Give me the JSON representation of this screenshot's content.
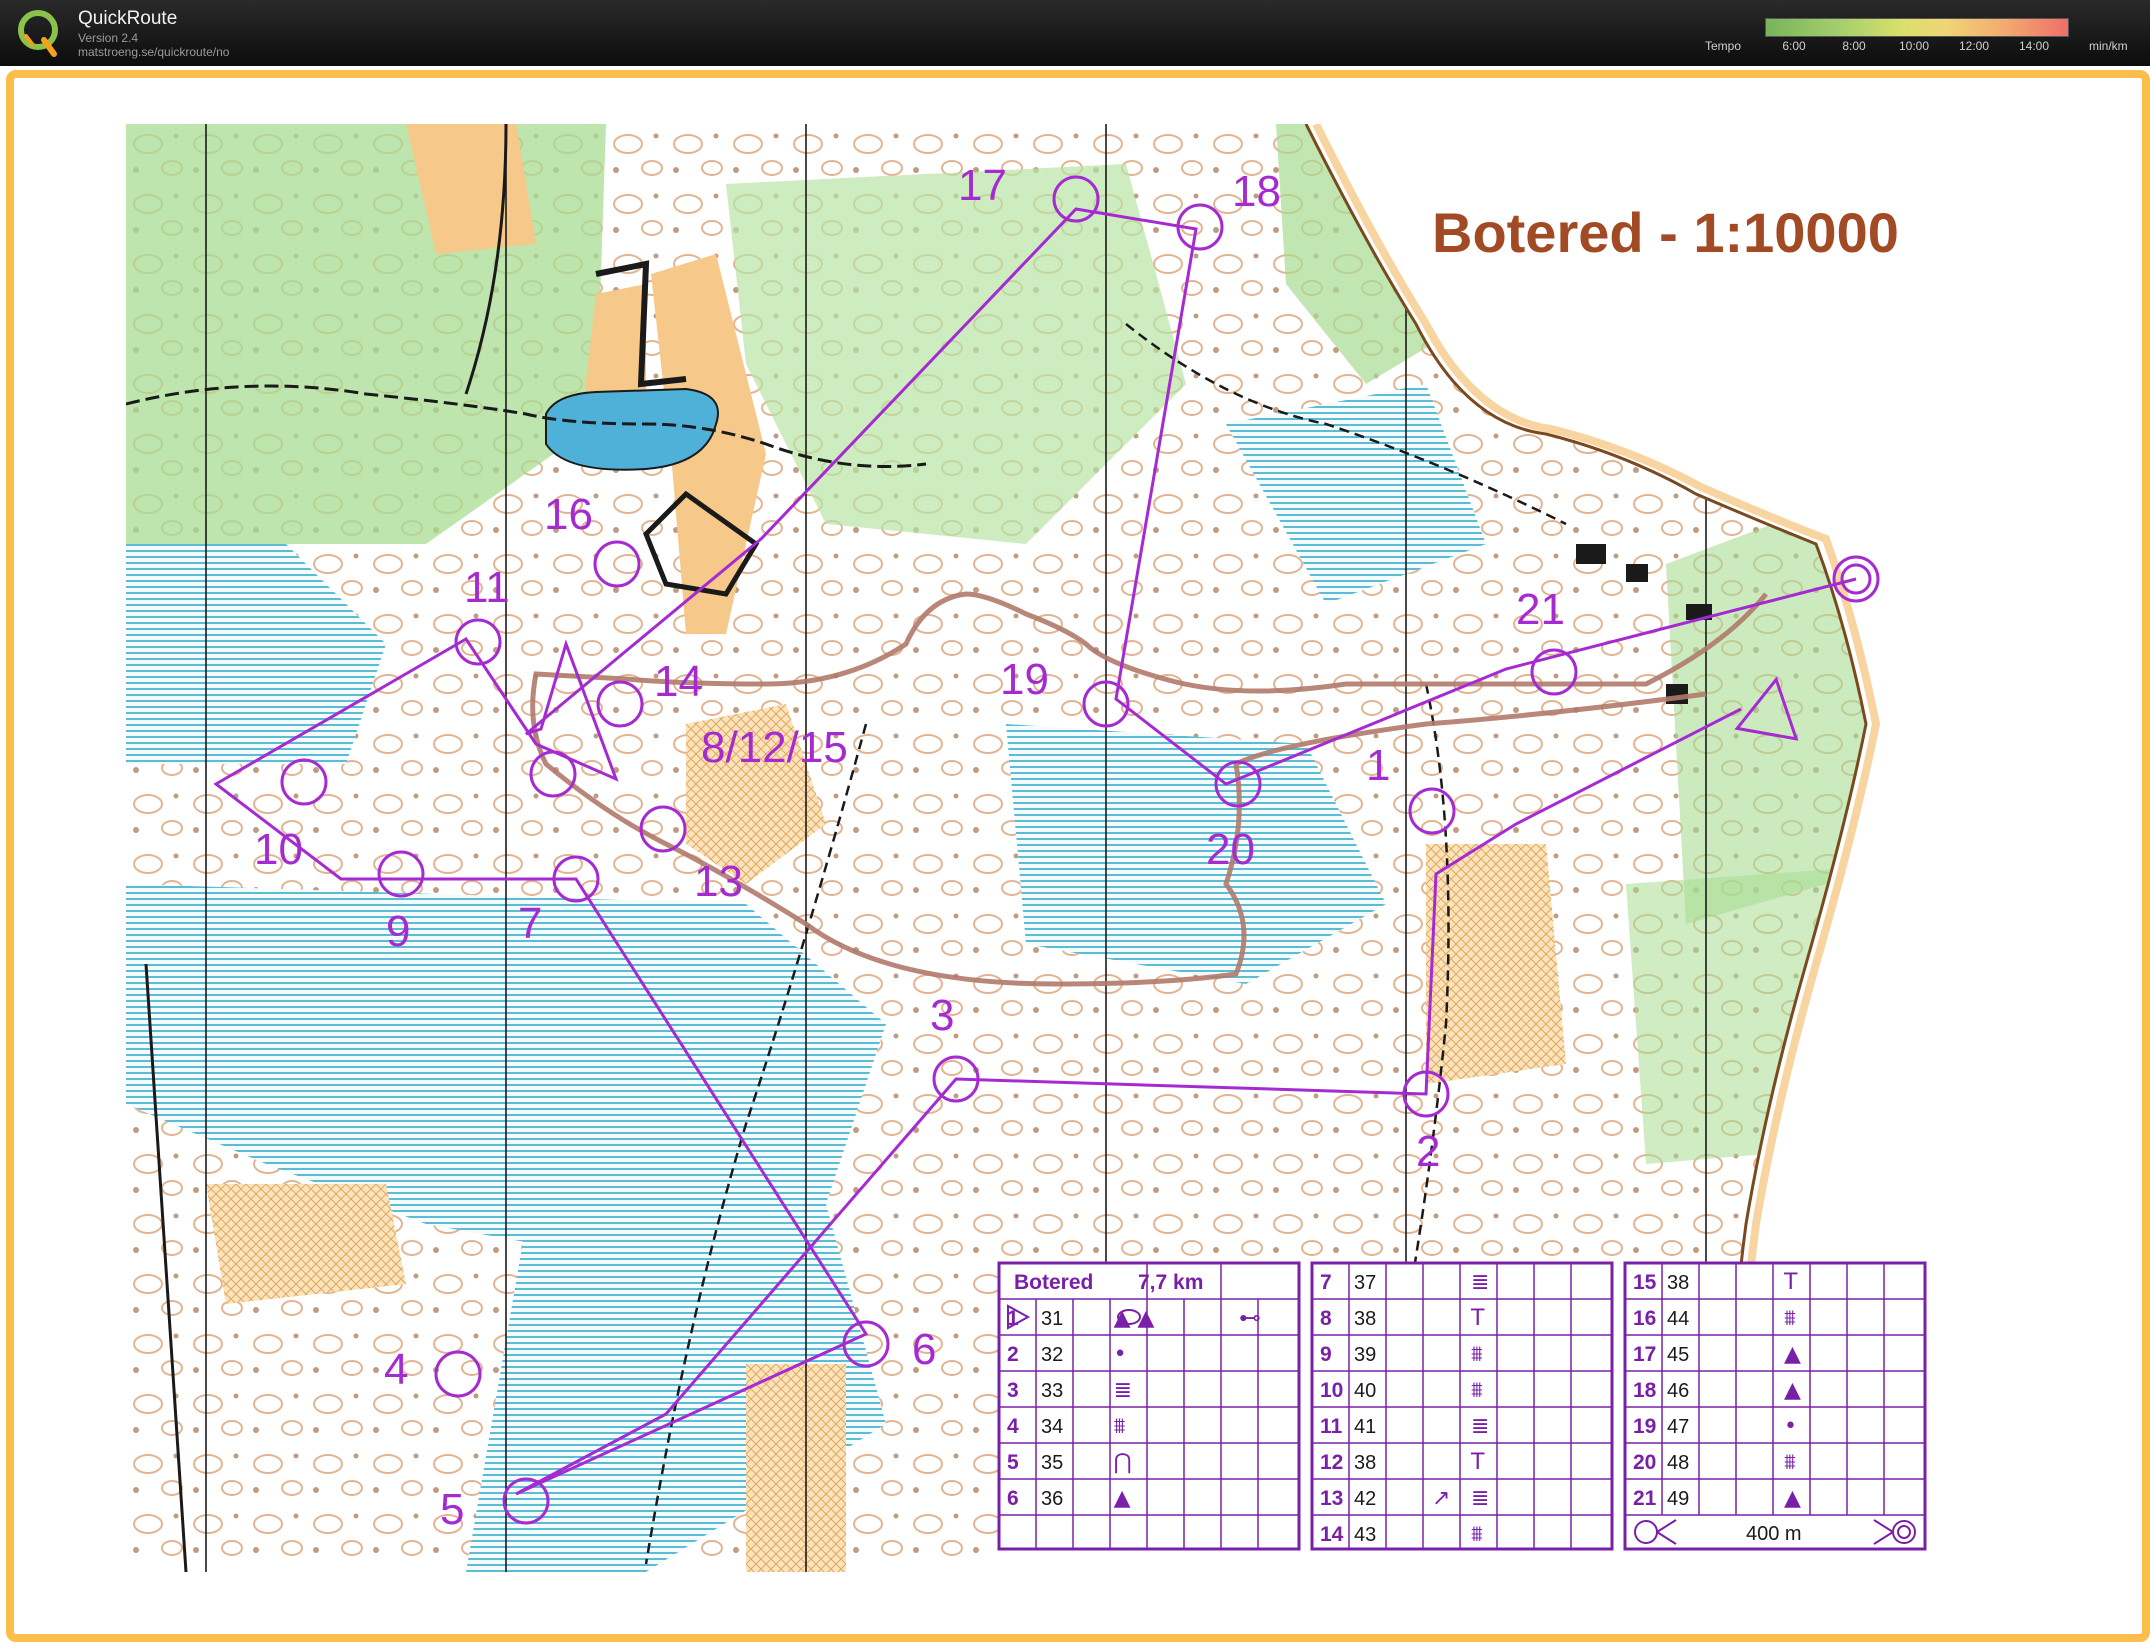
{
  "app": {
    "title": "QuickRoute",
    "version": "Version 2.4",
    "url": "matstroeng.se/quickroute/no"
  },
  "tempo": {
    "label": "Tempo",
    "ticks": [
      "6:00",
      "8:00",
      "10:00",
      "12:00",
      "14:00"
    ],
    "unit": "min/km"
  },
  "map": {
    "title": "Botered - 1:10000",
    "start_label": "start-triangle",
    "finish_label": "finish-double-circle"
  },
  "controls": [
    {
      "label": "1"
    },
    {
      "label": "2"
    },
    {
      "label": "3"
    },
    {
      "label": "4"
    },
    {
      "label": "5"
    },
    {
      "label": "6"
    },
    {
      "label": "7"
    },
    {
      "label": "8/12/15"
    },
    {
      "label": "9"
    },
    {
      "label": "10"
    },
    {
      "label": "11"
    },
    {
      "label": "13"
    },
    {
      "label": "14"
    },
    {
      "label": "16"
    },
    {
      "label": "17"
    },
    {
      "label": "18"
    },
    {
      "label": "19"
    },
    {
      "label": "20"
    },
    {
      "label": "21"
    }
  ],
  "description_sheet": {
    "event": "Botered",
    "length": "7,7 km",
    "scale_bar": "400 m",
    "columns": [
      [
        {
          "n": "1",
          "code": "31",
          "sym": "▲ ▲",
          "extra": "⊷"
        },
        {
          "n": "2",
          "code": "32",
          "sym": "•",
          "extra": ""
        },
        {
          "n": "3",
          "code": "33",
          "sym": "≣",
          "extra": ""
        },
        {
          "n": "4",
          "code": "34",
          "sym": "⩩",
          "extra": ""
        },
        {
          "n": "5",
          "code": "35",
          "sym": "⋂",
          "extra": ""
        },
        {
          "n": "6",
          "code": "36",
          "sym": "▲",
          "extra": ""
        }
      ],
      [
        {
          "n": "7",
          "code": "37",
          "sym": "≣",
          "dir": ""
        },
        {
          "n": "8",
          "code": "38",
          "sym": "T",
          "dir": ""
        },
        {
          "n": "9",
          "code": "39",
          "sym": "⩩",
          "dir": ""
        },
        {
          "n": "10",
          "code": "40",
          "sym": "⩩",
          "dir": ""
        },
        {
          "n": "11",
          "code": "41",
          "sym": "≣",
          "dir": ""
        },
        {
          "n": "12",
          "code": "38",
          "sym": "T",
          "dir": ""
        },
        {
          "n": "13",
          "code": "42",
          "sym": "≣",
          "dir": "↗"
        },
        {
          "n": "14",
          "code": "43",
          "sym": "⩩",
          "dir": ""
        }
      ],
      [
        {
          "n": "15",
          "code": "38",
          "sym": "T"
        },
        {
          "n": "16",
          "code": "44",
          "sym": "⩩"
        },
        {
          "n": "17",
          "code": "45",
          "sym": "▲"
        },
        {
          "n": "18",
          "code": "46",
          "sym": "▲"
        },
        {
          "n": "19",
          "code": "47",
          "sym": "•"
        },
        {
          "n": "20",
          "code": "48",
          "sym": "⩩"
        },
        {
          "n": "21",
          "code": "49",
          "sym": "▲"
        }
      ]
    ]
  },
  "colors": {
    "course": "#a62ad2",
    "frame": "#fbbe4b",
    "title": "#a24a24",
    "route": "#b07a6a",
    "open_land": "#f6c98a",
    "marsh": "#66c3d6",
    "forest_green": "#a8dc92"
  }
}
